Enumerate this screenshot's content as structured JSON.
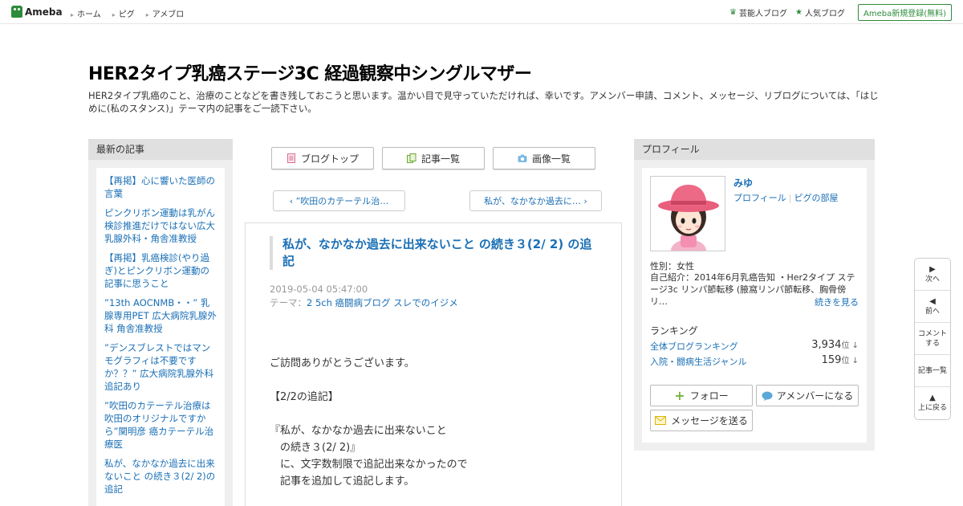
{
  "topbar": {
    "logo": "Ameba",
    "nav": [
      "ホーム",
      "ピグ",
      "アメブロ"
    ],
    "celebrity_blog": "芸能人ブログ",
    "popular_blog": "人気ブログ",
    "register": "Ameba新規登録(無料)"
  },
  "header": {
    "title": "HER2タイプ乳癌ステージ3C 経過観察中シングルマザー",
    "description": "HER2タイプ乳癌のこと、治療のことなどを書き残しておこうと思います。温かい目で見守っていただければ、幸いです。アメンバー申請、コメント、メッセージ、リブログについては、「はじめに(私のスタンス)」テーマ内の記事をご一読下さい。"
  },
  "recent": {
    "heading": "最新の記事",
    "items": [
      "【再掲】心に響いた医師の言葉",
      "ピンクリボン運動は乳がん検診推進だけではない広大乳腺外科・角舎准教授",
      "【再掲】乳癌検診(やり過ぎ)とピンクリボン運動の記事に思うこと",
      "”13th AOCNMB・・” 乳腺専用PET 広大病院乳腺外科 角舎准教授",
      "”デンスブレストではマンモグラフィは不要ですか？？” 広大病院乳腺外科 追記あり",
      "”吹田のカテーテル治療は吹田のオリジナルですから”関明彦 癌カテーテル治療医",
      "私が、なかなか過去に出来ないこと の続き３(2/ 2)の追記"
    ]
  },
  "tabs": {
    "blog_top": "ブログトップ",
    "article_list": "記事一覧",
    "image_list": "画像一覧"
  },
  "pager": {
    "prev": "”吹田のカテーテル治…",
    "next": "私が、なかなか過去に…"
  },
  "article": {
    "title": "私が、なかなか過去に出来ないこと の続き３(2/ 2) の追記",
    "date": "2019-05-04 05:47:00",
    "theme_label": "テーマ：",
    "theme": "2 5ch 癌闘病ブログ スレでのイジメ",
    "paragraphs": [
      "ご訪問ありがとうございます。",
      "【2/2の追記】",
      "『私が、なかなか過去に出来ないこと\n　の続き３(2/ 2)』\n　に、文字数制限で追記出来なかったので\n　記事を追加して追記します。"
    ]
  },
  "profile": {
    "heading": "プロフィール",
    "name": "みゆ",
    "link_profile": "プロフィール",
    "link_room": "ピグの部屋",
    "gender": "性別：女性",
    "intro": "自己紹介：2014年6月乳癌告知 ・Her2タイプ ステージ3c リンパ節転移 (腋窩リンパ節転移、胸骨傍リ…",
    "more": "続きを見る",
    "ranking_heading": "ランキング",
    "rankings": [
      {
        "name": "全体ブログランキング",
        "value": "3,934",
        "unit": "位 ↓"
      },
      {
        "name": "入院・闘病生活ジャンル",
        "value": "159",
        "unit": "位 ↓"
      }
    ],
    "follow": "フォロー",
    "amember": "アメンバーになる",
    "message": "メッセージを送る"
  },
  "sidenav": {
    "next": "次へ",
    "prev": "前へ",
    "comment": "コメントする",
    "list": "記事一覧",
    "top": "上に戻る"
  },
  "colors": {
    "brand_green": "#2d8c3c",
    "link_blue": "#1a6fb5"
  }
}
